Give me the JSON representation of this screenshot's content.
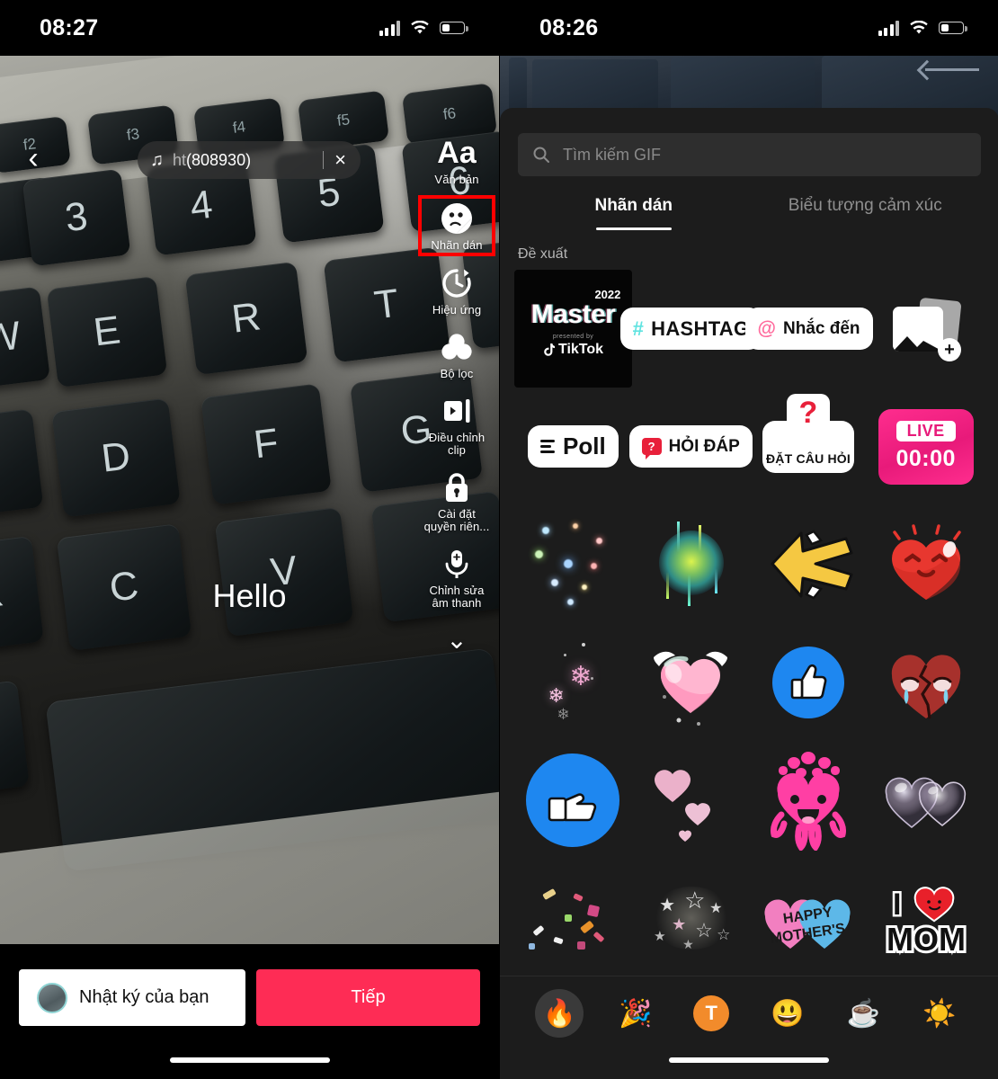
{
  "left": {
    "statusbar": {
      "time": "08:27"
    },
    "back_icon": "‹",
    "music": {
      "note_icon": "♫",
      "title_dim": "ht",
      "title": "(808930)",
      "close_icon": "×"
    },
    "overlay_text": "Hello",
    "tools": [
      {
        "name": "text",
        "glyph": "Aa",
        "label": "Văn bản",
        "highlighted": false
      },
      {
        "name": "sticker",
        "glyph": "sticker-icon",
        "label": "Nhãn dán",
        "highlighted": true
      },
      {
        "name": "effects",
        "glyph": "effects-icon",
        "label": "Hiệu ứng",
        "highlighted": false
      },
      {
        "name": "filter",
        "glyph": "filter-icon",
        "label": "Bộ lọc",
        "highlighted": false
      },
      {
        "name": "adjust-clip",
        "glyph": "clip-icon",
        "label": "Điều chỉnh clip",
        "highlighted": false
      },
      {
        "name": "privacy",
        "glyph": "lock-icon",
        "label": "Cài đặt quyền riên...",
        "highlighted": false
      },
      {
        "name": "audio-edit",
        "glyph": "mic-icon",
        "label": "Chỉnh sửa âm thanh",
        "highlighted": false
      }
    ],
    "collapse_icon": "⌄",
    "bottom": {
      "diary_label": "Nhật ký của bạn",
      "next_label": "Tiếp",
      "next_color": "#fe2c55"
    }
  },
  "right": {
    "statusbar": {
      "time": "08:26"
    },
    "search": {
      "placeholder": "Tìm kiếm GIF",
      "icon": "search-icon"
    },
    "tabs": [
      {
        "label": "Nhãn dán",
        "active": true
      },
      {
        "label": "Biểu tượng cảm xúc",
        "active": false
      }
    ],
    "section_title": "Đề xuất",
    "stickers": {
      "master": {
        "word": "Master",
        "year": "2022",
        "presented": "presented by",
        "brand": "TikTok"
      },
      "hashtag": {
        "hash": "#",
        "label": "HASHTAG"
      },
      "mention": {
        "at": "@",
        "label": "Nhắc đến"
      },
      "photo": {
        "name": "add-photo-sticker",
        "plus": "+"
      },
      "poll": {
        "label": "Poll"
      },
      "qa": {
        "label": "HỎ I ĐÁP",
        "text": "HỎI ĐÁP",
        "badge": "?"
      },
      "ask": {
        "label": "ĐẶT CÂU HỎI",
        "mark": "?"
      },
      "live": {
        "badge": "LIVE",
        "time": "00:00",
        "color": "#e81a7a"
      }
    },
    "grid_rows": [
      [
        "sparkles-sticker",
        "fireworks-sticker",
        "yellow-arrow-sticker",
        "happy-heart-sticker"
      ],
      [
        "cherry-blossom-sticker",
        "winged-heart-sticker",
        "facebook-like-sticker",
        "broken-heart-crying-sticker"
      ],
      [
        "facebook-point-sticker",
        "pink-hearts-sticker",
        "pink-heart-octopus-sticker",
        "bubble-hearts-sticker"
      ],
      [
        "confetti-sticker",
        "stars-sticker",
        "happy-mothers-day-sticker",
        "i-love-mom-sticker"
      ]
    ],
    "categories": [
      {
        "name": "trending",
        "glyph": "🔥",
        "active": true
      },
      {
        "name": "party",
        "glyph": "🎉",
        "active": false
      },
      {
        "name": "text",
        "glyph": "T",
        "active": false
      },
      {
        "name": "smileys",
        "glyph": "😃",
        "active": false
      },
      {
        "name": "food-drink",
        "glyph": "☕",
        "active": false
      },
      {
        "name": "nature",
        "glyph": "☀️",
        "active": false
      }
    ]
  }
}
